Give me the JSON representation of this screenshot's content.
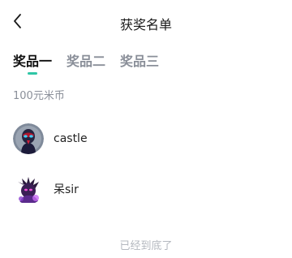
{
  "header": {
    "title": "获奖名单"
  },
  "tabs": [
    {
      "label": "奖品一",
      "active": true
    },
    {
      "label": "奖品二",
      "active": false
    },
    {
      "label": "奖品三",
      "active": false
    }
  ],
  "prize": {
    "label": "100元米币"
  },
  "winners": [
    {
      "name": "castle",
      "avatar": "avatar-castle"
    },
    {
      "name": "呆sir",
      "avatar": "avatar-daisir"
    }
  ],
  "footer": {
    "end_text": "已经到底了"
  },
  "colors": {
    "accent": "#2fc6a6",
    "muted": "#8a8f99"
  }
}
